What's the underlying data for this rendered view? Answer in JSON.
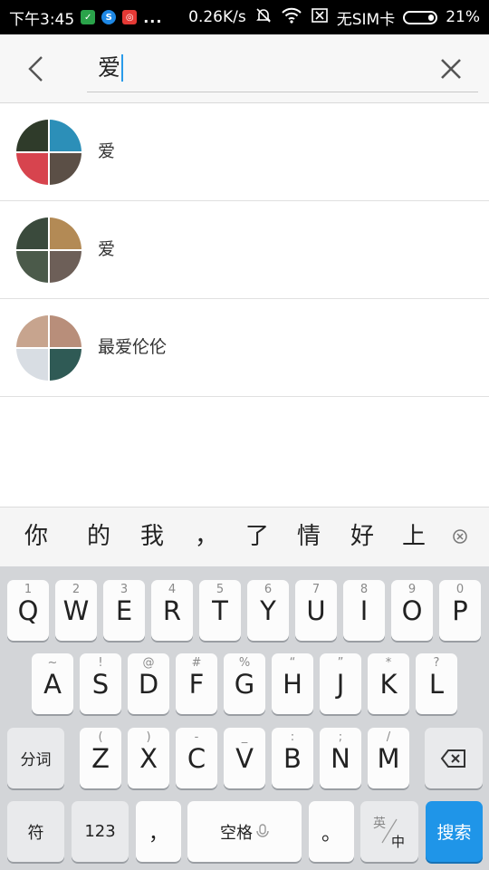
{
  "status_bar": {
    "time": "下午3:45",
    "more": "...",
    "speed": "0.26K/s",
    "sim": "无SIM卡",
    "battery": "21%",
    "battery_level": 0.21,
    "app_icons": [
      "green-app-icon",
      "blue-s-app-icon",
      "red-app-icon"
    ]
  },
  "search": {
    "query": "爱"
  },
  "results": [
    {
      "name": "爱",
      "avatar_colors": [
        "#2f3b2a",
        "#2c8fb8",
        "#d7444e",
        "#5b4f46"
      ]
    },
    {
      "name": "爱",
      "avatar_colors": [
        "#3a4a3c",
        "#b38a55",
        "#4b5a4a",
        "#6d5f58"
      ]
    },
    {
      "name": "最爱伦伦",
      "avatar_colors": [
        "#c7a48e",
        "#b88e7a",
        "#d8dde3",
        "#2f5a55"
      ]
    }
  ],
  "candidates": [
    "你",
    "的",
    "我",
    "，",
    "了",
    "情",
    "好",
    "上"
  ],
  "keyboard": {
    "row1": [
      {
        "hint": "1",
        "key": "Q"
      },
      {
        "hint": "2",
        "key": "W"
      },
      {
        "hint": "3",
        "key": "E"
      },
      {
        "hint": "4",
        "key": "R"
      },
      {
        "hint": "5",
        "key": "T"
      },
      {
        "hint": "6",
        "key": "Y"
      },
      {
        "hint": "7",
        "key": "U"
      },
      {
        "hint": "8",
        "key": "I"
      },
      {
        "hint": "9",
        "key": "O"
      },
      {
        "hint": "0",
        "key": "P"
      }
    ],
    "row2": [
      {
        "hint": "~",
        "key": "A"
      },
      {
        "hint": "!",
        "key": "S"
      },
      {
        "hint": "@",
        "key": "D"
      },
      {
        "hint": "#",
        "key": "F"
      },
      {
        "hint": "%",
        "key": "G"
      },
      {
        "hint": "“",
        "key": "H"
      },
      {
        "hint": "”",
        "key": "J"
      },
      {
        "hint": "*",
        "key": "K"
      },
      {
        "hint": "?",
        "key": "L"
      }
    ],
    "row3": [
      {
        "hint": "(",
        "key": "Z"
      },
      {
        "hint": ")",
        "key": "X"
      },
      {
        "hint": "-",
        "key": "C"
      },
      {
        "hint": "_",
        "key": "V"
      },
      {
        "hint": ":",
        "key": "B"
      },
      {
        "hint": ";",
        "key": "N"
      },
      {
        "hint": "/",
        "key": "M"
      }
    ],
    "segment_label": "分词",
    "symbol_label": "符",
    "num_label": "123",
    "comma_label": "，",
    "space_label": "空格",
    "period_label": "。",
    "lang_top": "英",
    "lang_bottom": "中",
    "search_label": "搜索",
    "accent_color": "#1f95e8"
  }
}
